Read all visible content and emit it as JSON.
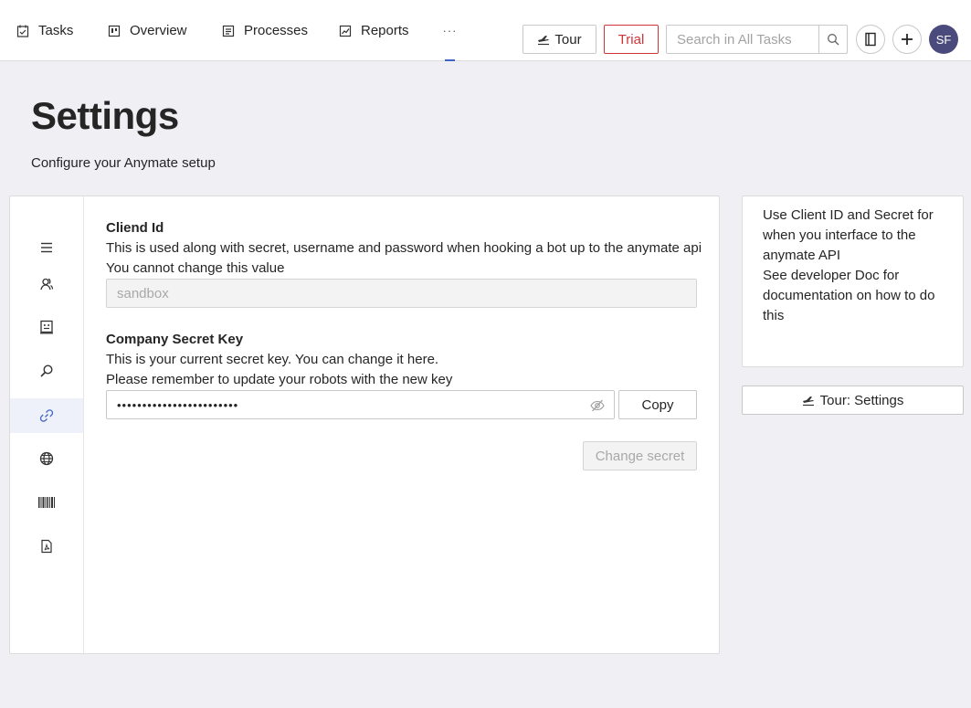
{
  "nav": {
    "items": [
      {
        "label": "Tasks",
        "icon": "tasks-icon"
      },
      {
        "label": "Overview",
        "icon": "overview-icon"
      },
      {
        "label": "Processes",
        "icon": "processes-icon"
      },
      {
        "label": "Reports",
        "icon": "reports-icon"
      }
    ],
    "more_label": "···",
    "tour_label": "Tour",
    "trial_label": "Trial",
    "search_placeholder": "Search in All Tasks",
    "avatar_initials": "SF",
    "accent_color": "#3f64c4",
    "trial_color": "#d13438",
    "avatar_color": "#4b4a7c"
  },
  "header": {
    "title": "Settings",
    "subtitle": "Configure your Anymate setup"
  },
  "sidebar": {
    "items": [
      {
        "icon": "menu-icon",
        "active": false
      },
      {
        "icon": "users-icon",
        "active": false
      },
      {
        "icon": "robot-icon",
        "active": false
      },
      {
        "icon": "search-icon",
        "active": false
      },
      {
        "icon": "link-icon",
        "active": true
      },
      {
        "icon": "globe-icon",
        "active": false
      },
      {
        "icon": "barcode-icon",
        "active": false
      },
      {
        "icon": "pdf-icon",
        "active": false
      }
    ]
  },
  "client": {
    "title": "Cliend Id",
    "desc1": "This is used along with secret, username and password when hooking a bot up to the anymate api",
    "desc2": "You cannot change this value",
    "value": "sandbox"
  },
  "secret": {
    "title": "Company Secret Key",
    "desc1": "This is your current secret key. You can change it here.",
    "desc2": "Please remember to update your robots with the new key",
    "value": "••••••••••••••••••••••••",
    "copy_label": "Copy",
    "change_label": "Change secret"
  },
  "info": {
    "lines": [
      "Use Client ID and Secret for when you interface to the anymate API",
      "See developer Doc for documentation on how to do this"
    ],
    "tour_label": "Tour: Settings"
  }
}
